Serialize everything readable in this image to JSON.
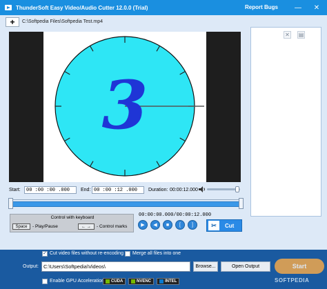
{
  "window": {
    "title": "ThunderSoft Easy Video/Audio Cutter 12.0.0 (Trial)",
    "report_bugs": "Report Bugs",
    "minimize": "—",
    "close": "✕"
  },
  "toolbar": {
    "add_label": "+",
    "file_path": "C:\\Softpedia Files\\Softpedia Test.mp4"
  },
  "preview": {
    "digit": "3",
    "accent": "#2ee6f5"
  },
  "right_panel": {
    "remove_label": "✕",
    "clear_label": "▤"
  },
  "timing": {
    "start_label": "Start:",
    "start_value": "00 :00 :00 .000",
    "end_label": "End:",
    "end_value": "00 :00 :12 .000",
    "duration_label": "Duration:",
    "duration_value": "00:00:12.000",
    "volume_level": 0.92
  },
  "keyboard": {
    "title": "Control with keyboard",
    "space_key": "Space",
    "space_text": "- Play/Pause",
    "arrow_key": "← →",
    "arrow_text": "- Control marks"
  },
  "player": {
    "time": "00:00:00.000/00:00:12.000",
    "cut_label": "Cut"
  },
  "options": {
    "cut_without_reencoding": "Cut video files without re-encoding",
    "cut_without_reencoding_checked": true,
    "merge_all": "Merge all files into one",
    "merge_all_checked": false,
    "output_label": "Output:",
    "output_value": "C:\\Users\\Softpedia\\Videos\\",
    "browse_label": "Browse...",
    "open_output_label": "Open Output",
    "start_label": "Start",
    "gpu_label": "Enable GPU Acceleration",
    "gpu_checked": false,
    "gpu_options": [
      "CUDA",
      "NVENC",
      "INTEL"
    ],
    "watermark": "SOFTPEDIA"
  }
}
